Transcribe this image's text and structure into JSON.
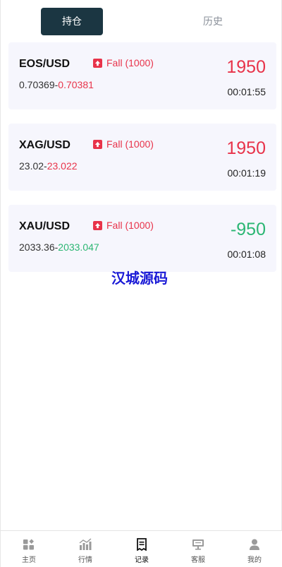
{
  "tabs": [
    {
      "label": "持仓",
      "active": true
    },
    {
      "label": "历史",
      "active": false
    }
  ],
  "positions": [
    {
      "symbol": "EOS/USD",
      "direction": "Fall",
      "amount": "(1000)",
      "open_price": "0.70369",
      "separator": "-",
      "current_price": "0.70381",
      "current_trend": "up",
      "pnl": "1950",
      "pnl_trend": "up",
      "time": "00:01:55"
    },
    {
      "symbol": "XAG/USD",
      "direction": "Fall",
      "amount": "(1000)",
      "open_price": "23.02",
      "separator": "-",
      "current_price": "23.022",
      "current_trend": "up",
      "pnl": "1950",
      "pnl_trend": "up",
      "time": "00:01:19"
    },
    {
      "symbol": "XAU/USD",
      "direction": "Fall",
      "amount": "(1000)",
      "open_price": "2033.36",
      "separator": "-",
      "current_price": "2033.047",
      "current_trend": "down",
      "pnl": "-950",
      "pnl_trend": "down",
      "time": "00:01:08"
    }
  ],
  "watermark": "汉城源码",
  "colors": {
    "up": "#e8334a",
    "down": "#2bb673",
    "active_tab_bg": "#1b3642",
    "card_bg": "#f6f6fd"
  },
  "bottom_nav": [
    {
      "label": "主页",
      "icon": "home-icon",
      "active": false
    },
    {
      "label": "行情",
      "icon": "chart-icon",
      "active": false
    },
    {
      "label": "记录",
      "icon": "record-icon",
      "active": true
    },
    {
      "label": "客服",
      "icon": "support-icon",
      "active": false
    },
    {
      "label": "我的",
      "icon": "user-icon",
      "active": false
    }
  ]
}
